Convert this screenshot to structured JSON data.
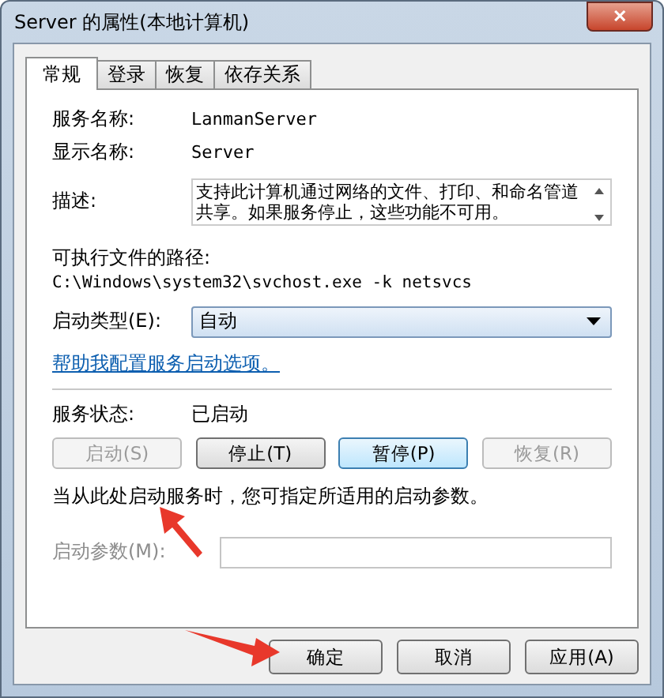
{
  "window": {
    "title": "Server 的属性(本地计算机)",
    "close": "✕"
  },
  "tabs": [
    {
      "label": "常规",
      "selected": true
    },
    {
      "label": "登录",
      "selected": false
    },
    {
      "label": "恢复",
      "selected": false
    },
    {
      "label": "依存关系",
      "selected": false
    }
  ],
  "fields": [
    {
      "label": "服务名称:",
      "value": "LanmanServer"
    },
    {
      "label": "显示名称:",
      "value": "Server"
    }
  ],
  "description": {
    "label": "描述:",
    "value": "支持此计算机通过网络的文件、打印、和命名管道共享。如果服务停止，这些功能不可用。"
  },
  "path": {
    "label": "可执行文件的路径:",
    "value": "C:\\Windows\\system32\\svchost.exe -k netsvcs"
  },
  "startup_type": {
    "label": "启动类型(E):",
    "value": "自动"
  },
  "help_link": "帮助我配置服务启动选项。",
  "status": {
    "label": "服务状态:",
    "value": "已启动"
  },
  "service_buttons": [
    {
      "label": "启动(S)",
      "disabled": true,
      "focused": false
    },
    {
      "label": "停止(T)",
      "disabled": false,
      "focused": false
    },
    {
      "label": "暂停(P)",
      "disabled": false,
      "focused": true
    },
    {
      "label": "恢复(R)",
      "disabled": true,
      "focused": false
    }
  ],
  "hint": "当从此处启动服务时，您可指定所适用的启动参数。",
  "start_params": {
    "label": "启动参数(M):",
    "disabled": true
  },
  "dialog_buttons": [
    {
      "label": "确定"
    },
    {
      "label": "取消"
    },
    {
      "label": "应用(A)"
    }
  ]
}
